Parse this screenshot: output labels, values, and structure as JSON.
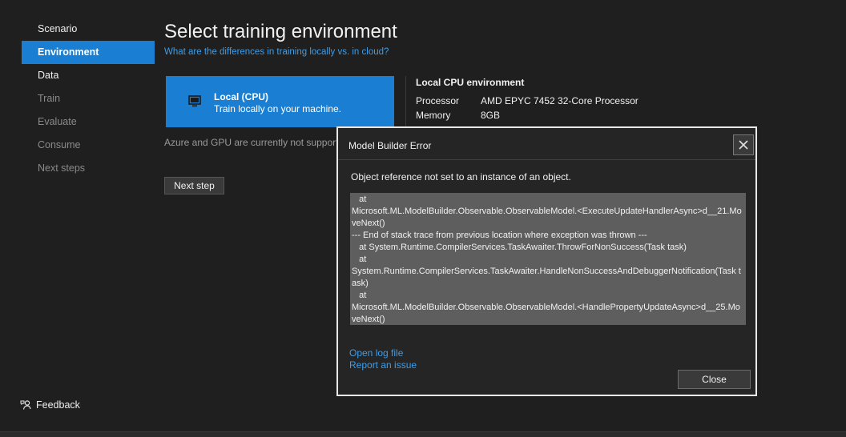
{
  "sidebar": {
    "items": [
      {
        "label": "Scenario"
      },
      {
        "label": "Environment"
      },
      {
        "label": "Data"
      },
      {
        "label": "Train"
      },
      {
        "label": "Evaluate"
      },
      {
        "label": "Consume"
      },
      {
        "label": "Next steps"
      }
    ],
    "feedback_label": "Feedback"
  },
  "main": {
    "title": "Select training environment",
    "help_link": "What are the differences in training locally vs. in cloud?",
    "env_card": {
      "title": "Local (CPU)",
      "description": "Train locally on your machine.",
      "icon": "monitor-icon"
    },
    "specs": {
      "title": "Local CPU environment",
      "processor_label": "Processor",
      "processor_value": "AMD EPYC 7452 32-Core Processor",
      "memory_label": "Memory",
      "memory_value": "8GB"
    },
    "notice": "Azure and GPU are currently not supported",
    "next_button": "Next step"
  },
  "dialog": {
    "title": "Model Builder Error",
    "message": "Object reference not set to an instance of an object.",
    "stack_trace": "   at\nMicrosoft.ML.ModelBuilder.Observable.ObservableModel.<ExecuteUpdateHandlerAsync>d__21.MoveNext()\n--- End of stack trace from previous location where exception was thrown ---\n   at System.Runtime.CompilerServices.TaskAwaiter.ThrowForNonSuccess(Task task)\n   at\nSystem.Runtime.CompilerServices.TaskAwaiter.HandleNonSuccessAndDebuggerNotification(Task task)\n   at\nMicrosoft.ML.ModelBuilder.Observable.ObservableModel.<HandlePropertyUpdateAsync>d__25.MoveNext()",
    "open_log_link": "Open log file",
    "report_link": "Report an issue",
    "close_button": "Close"
  },
  "colors": {
    "background": "#1f1f1f",
    "accent": "#1a7fd3",
    "link": "#3e9de8",
    "stack_bg": "#5e5e5e"
  }
}
